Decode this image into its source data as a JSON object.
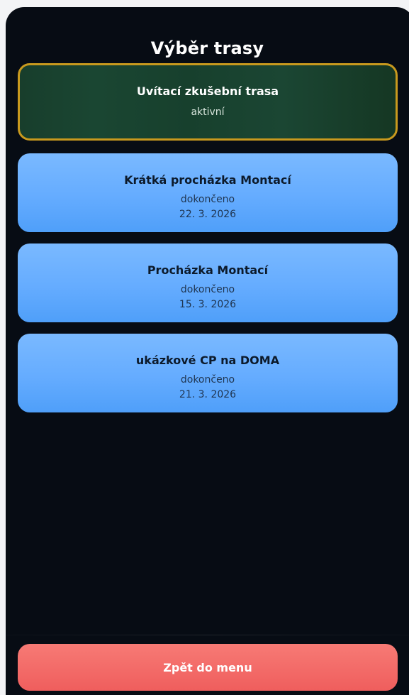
{
  "screen": {
    "title": "Výběr trasy"
  },
  "routes": [
    {
      "name": "Uvítací zkušební trasa",
      "status": "aktivní",
      "date": null,
      "state": "active"
    },
    {
      "name": "Krátká procházka Montací",
      "status": "dokončeno",
      "date": "22. 3. 2026",
      "state": "done"
    },
    {
      "name": "Procházka Montací",
      "status": "dokončeno",
      "date": "15. 3. 2026",
      "state": "done"
    },
    {
      "name": "ukázkové CP na DOMA",
      "status": "dokončeno",
      "date": "21. 3. 2026",
      "state": "done"
    }
  ],
  "footer": {
    "back_label": "Zpět do menu"
  },
  "colors": {
    "background": "#070c14",
    "active_card": "#1a4632",
    "active_border": "#c8991e",
    "completed_card": "#65acff",
    "back_button": "#f06b68"
  }
}
